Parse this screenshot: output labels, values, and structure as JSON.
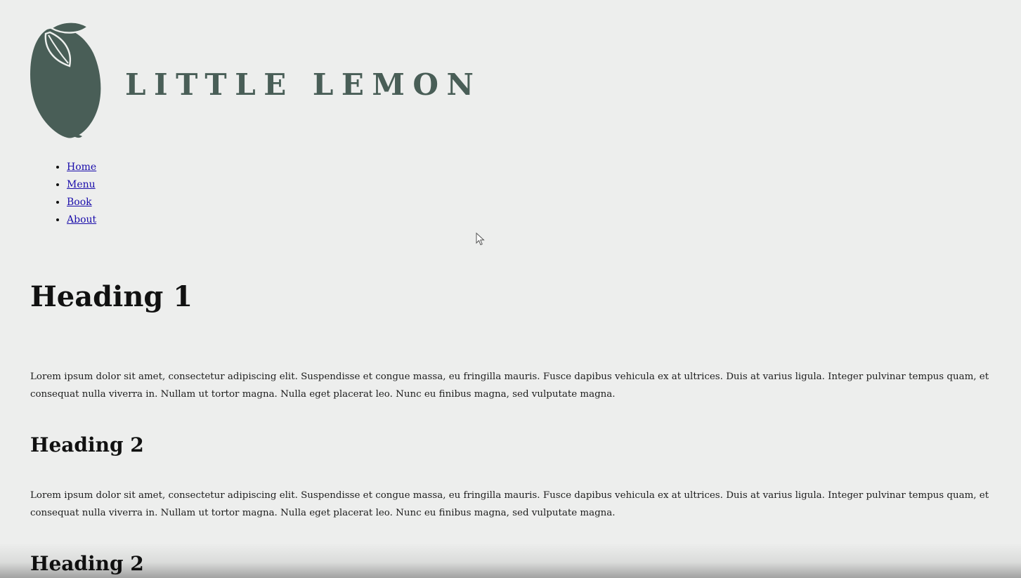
{
  "brand": {
    "name": "LITTLE LEMON",
    "color": "#495e57"
  },
  "nav": {
    "items": [
      {
        "label": "Home"
      },
      {
        "label": "Menu"
      },
      {
        "label": "Book"
      },
      {
        "label": "About"
      }
    ],
    "link_color": "#1a0dab"
  },
  "main": {
    "heading1": "Heading 1",
    "paragraph1": "Lorem ipsum dolor sit amet, consectetur adipiscing elit. Suspendisse et congue massa, eu fringilla mauris. Fusce dapibus vehicula ex at ultrices. Duis at varius ligula. Integer pulvinar tempus quam, et consequat nulla viverra in. Nullam ut tortor magna. Nulla eget placerat leo. Nunc eu finibus magna, sed vulputate magna.",
    "heading2a": "Heading 2",
    "paragraph2": "Lorem ipsum dolor sit amet, consectetur adipiscing elit. Suspendisse et congue massa, eu fringilla mauris. Fusce dapibus vehicula ex at ultrices. Duis at varius ligula. Integer pulvinar tempus quam, et consequat nulla viverra in. Nullam ut tortor magna. Nulla eget placerat leo. Nunc eu finibus magna, sed vulputate magna.",
    "heading2b": "Heading 2"
  },
  "colors": {
    "background": "#edeeed",
    "text": "#111111"
  },
  "icons": {
    "logo": "lemon-logo-icon",
    "cursor": "mouse-cursor-icon"
  }
}
